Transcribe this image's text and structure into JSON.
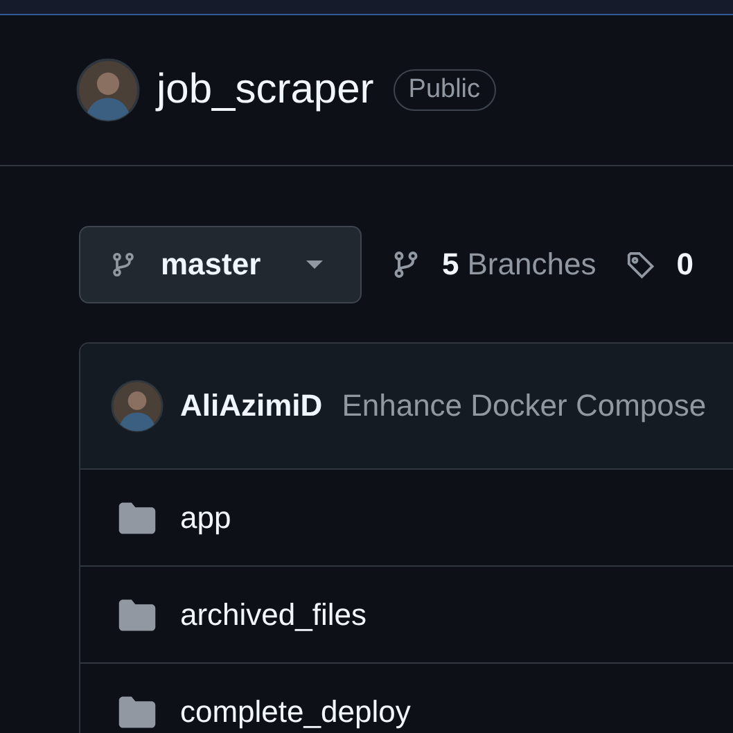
{
  "repo": {
    "name": "job_scraper",
    "visibility": "Public"
  },
  "branch_selector": {
    "label": "master"
  },
  "stats": [
    {
      "kind": "branches",
      "count": "5",
      "label": "Branches"
    },
    {
      "kind": "tags",
      "count": "0"
    }
  ],
  "latest_commit": {
    "author": "AliAzimiD",
    "message": "Enhance Docker Compose"
  },
  "files": [
    {
      "kind": "folder",
      "name": "app"
    },
    {
      "kind": "folder",
      "name": "archived_files"
    },
    {
      "kind": "folder",
      "name": "complete_deploy"
    }
  ]
}
